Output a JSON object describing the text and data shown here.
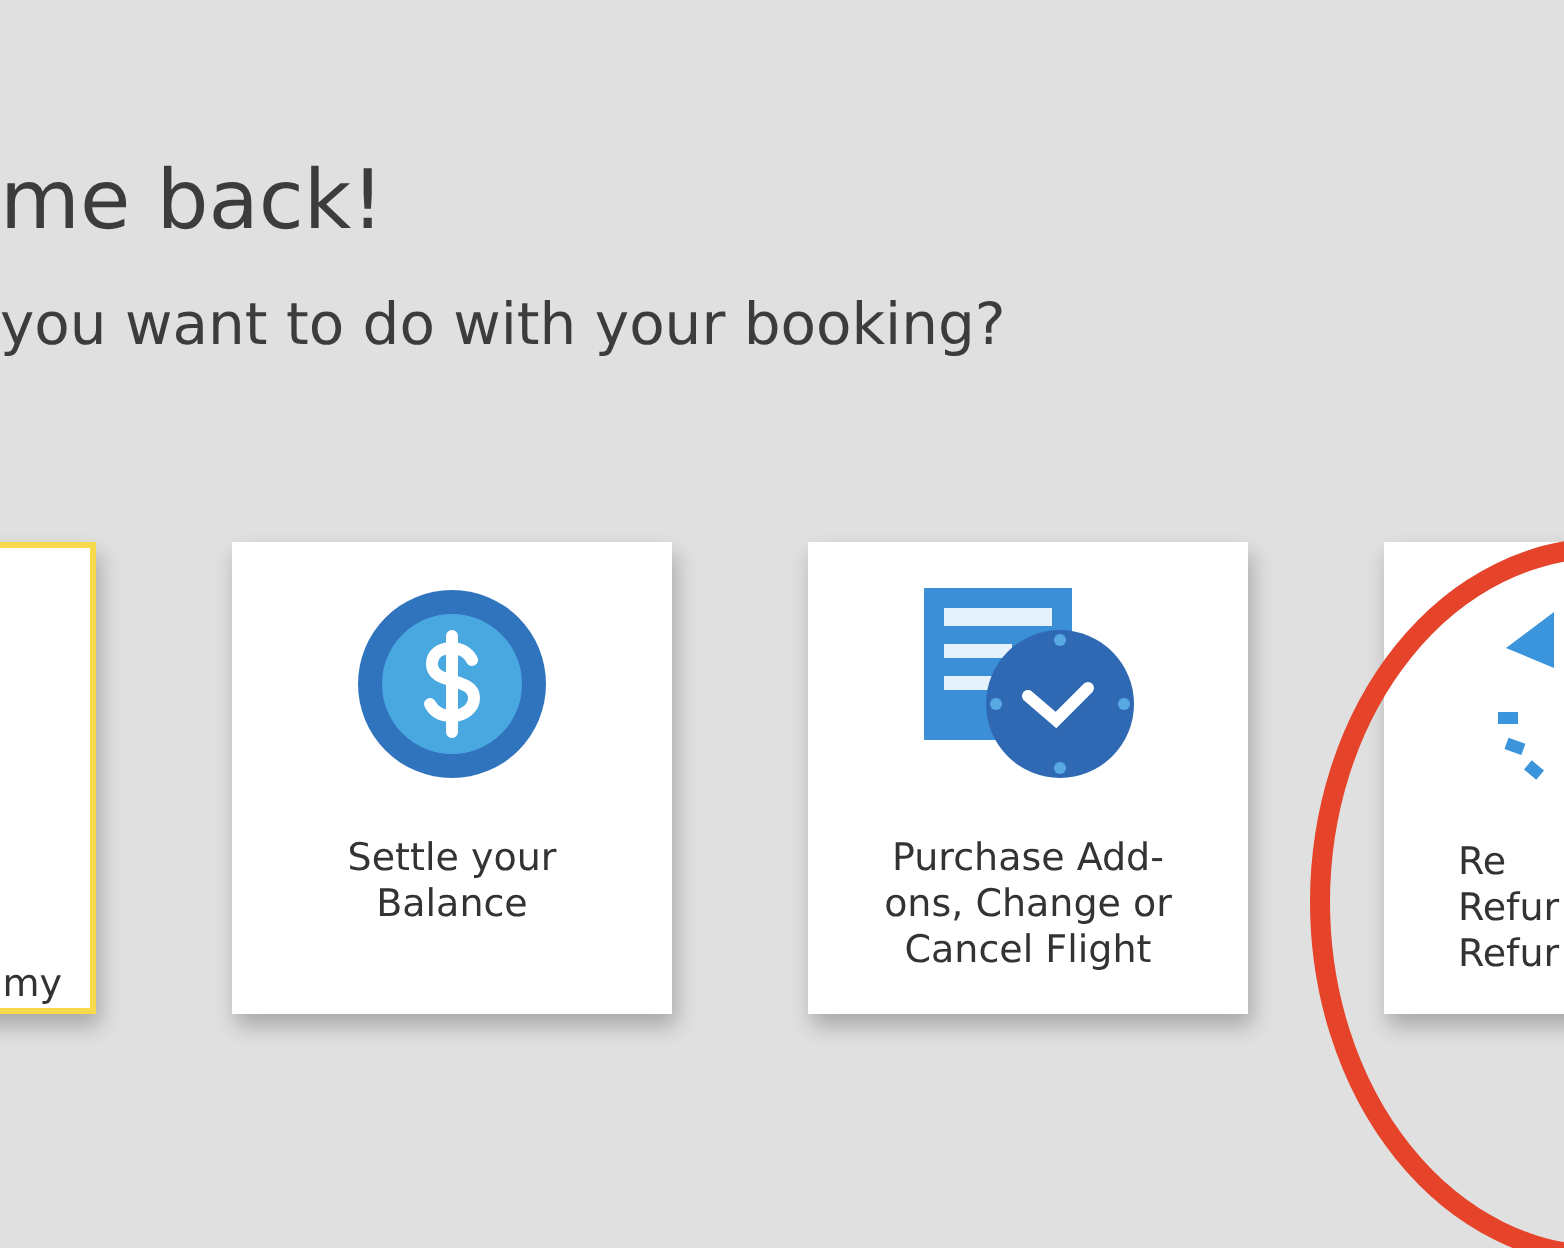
{
  "heading": "me back!",
  "subheading": "you want to do with your booking?",
  "cards": [
    {
      "kind": "plain",
      "lines": [
        "my"
      ],
      "selected": true
    },
    {
      "kind": "coin",
      "lines": [
        "Settle your",
        "Balance"
      ],
      "selected": false
    },
    {
      "kind": "schedule",
      "lines": [
        "Purchase Add-",
        "ons, Change or",
        "Cancel Flight"
      ],
      "selected": false
    },
    {
      "kind": "refund",
      "lines": [
        "Re",
        "Refur",
        "Refur"
      ],
      "selected": false
    }
  ]
}
